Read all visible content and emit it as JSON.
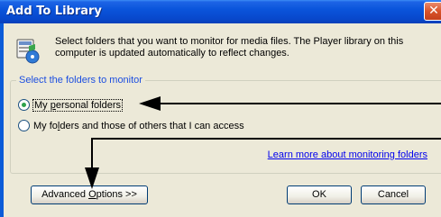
{
  "window": {
    "title": "Add To Library",
    "close_glyph": "✕"
  },
  "description": "Select folders that you want to monitor for media files. The Player library on this computer is updated automatically to reflect changes.",
  "group": {
    "legend": "Select the folders to monitor",
    "options": [
      {
        "prefix": "My ",
        "accel": "p",
        "suffix": "ersonal folders",
        "checked": true
      },
      {
        "prefix": "My fo",
        "accel": "l",
        "suffix": "ders and those of others that I can access",
        "checked": false
      }
    ],
    "link": "Learn more about monitoring folders"
  },
  "buttons": {
    "advanced_prefix": "Advanced ",
    "advanced_accel": "O",
    "advanced_suffix": "ptions >>",
    "ok": "OK",
    "cancel": "Cancel"
  },
  "colors": {
    "title_bar": "#0a54db",
    "dialog_bg": "#ece9d8",
    "link": "#0000ee",
    "legend": "#1c4ee0"
  },
  "icons": [
    "media-library-icon",
    "close-icon",
    "annotation-arrow-icon"
  ]
}
